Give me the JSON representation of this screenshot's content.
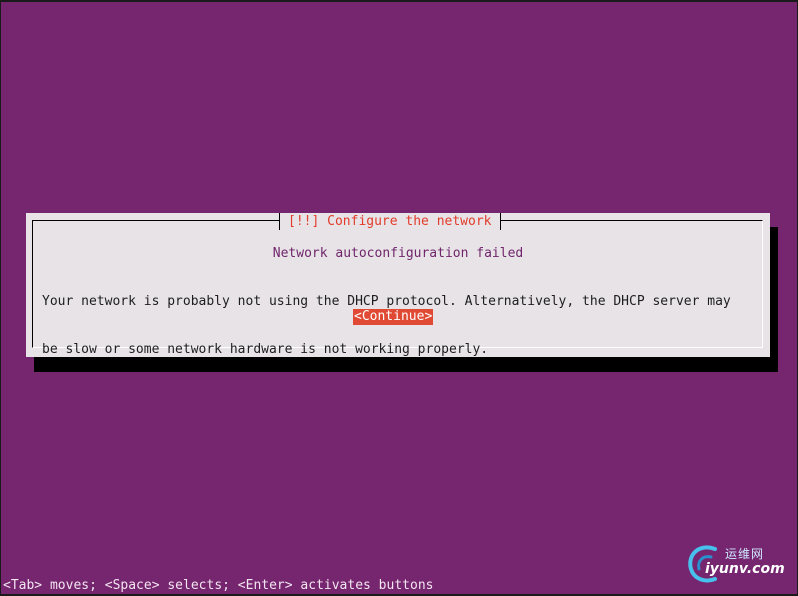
{
  "dialog": {
    "title": "[!!] Configure the network",
    "subtitle": "Network autoconfiguration failed",
    "message_lines": [
      "Your network is probably not using the DHCP protocol. Alternatively, the DHCP server may",
      "be slow or some network hardware is not working properly."
    ],
    "continue_label": "<Continue>"
  },
  "footer": {
    "hint": "<Tab> moves; <Space> selects; <Enter> activates buttons"
  },
  "watermark": {
    "cn": "运维网",
    "en": "iyunv.com"
  },
  "colors": {
    "background": "#76256f",
    "dialog": "#e7e3e7",
    "title": "#e23c2a",
    "subtitle": "#70256b",
    "button": "#e04a34"
  },
  "icons": {
    "watermark_logo": "swirl-logo-icon"
  }
}
